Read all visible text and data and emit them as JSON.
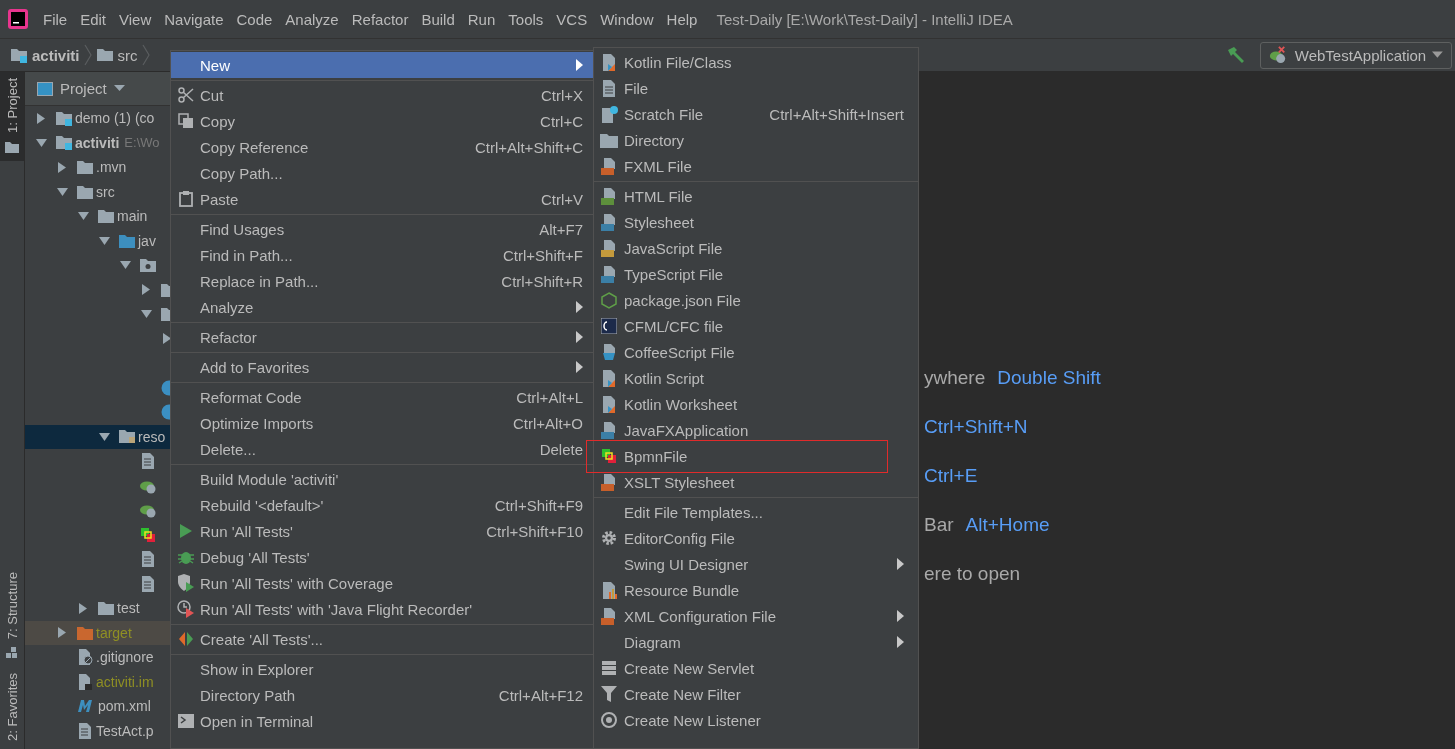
{
  "title_bar": {
    "menus": [
      "File",
      "Edit",
      "View",
      "Navigate",
      "Code",
      "Analyze",
      "Refactor",
      "Build",
      "Run",
      "Tools",
      "VCS",
      "Window",
      "Help"
    ],
    "title": "Test-Daily [E:\\Work\\Test-Daily] - IntelliJ IDEA"
  },
  "nav_bar": {
    "crumbs": [
      {
        "label": "activiti",
        "kind": "module"
      },
      {
        "label": "src",
        "kind": "folder"
      }
    ],
    "run_config": "WebTestApplication"
  },
  "tool_strip": {
    "top": [
      {
        "label": "1: Project",
        "selected": true
      }
    ],
    "bottom": [
      {
        "label": "7: Structure",
        "selected": false
      },
      {
        "label": "2: Favorites",
        "selected": false
      }
    ]
  },
  "project": {
    "title": "Project",
    "tree": [
      {
        "label": "demo (1) (co",
        "kind": "module",
        "expanded": false,
        "selected": false
      },
      {
        "label": "activiti",
        "extra": "E:\\Wo",
        "kind": "module",
        "expanded": true,
        "selected": false,
        "children": [
          {
            "label": ".mvn",
            "kind": "folder",
            "expanded": false,
            "selected": false
          },
          {
            "label": "src",
            "kind": "folder",
            "expanded": true,
            "selected": false,
            "children": [
              {
                "label": "main",
                "kind": "folder",
                "expanded": true,
                "selected": false,
                "children": [
                  {
                    "label": "jav",
                    "kind": "source-folder",
                    "expanded": true,
                    "selected": false,
                    "children": [
                      {
                        "kind": "package",
                        "expanded": true,
                        "selected": false,
                        "children": [
                          {
                            "kind": "folder",
                            "expanded": false,
                            "selected": false
                          },
                          {
                            "kind": "folder",
                            "expanded": true,
                            "selected": false,
                            "children": [
                              {
                                "kind": "offscreen",
                                "expanded": false,
                                "selected": false
                              },
                              {
                                "kind": "blank",
                                "selected": false
                              }
                            ]
                          },
                          {
                            "kind": "class",
                            "selected": false
                          },
                          {
                            "kind": "class",
                            "selected": false
                          }
                        ]
                      }
                    ]
                  },
                  {
                    "label": "reso",
                    "kind": "resources-folder",
                    "expanded": true,
                    "selected": true,
                    "children": [
                      {
                        "kind": "file",
                        "selected": false
                      },
                      {
                        "kind": "spring",
                        "selected": false
                      },
                      {
                        "kind": "spring",
                        "selected": false
                      },
                      {
                        "kind": "bpmn",
                        "selected": false
                      },
                      {
                        "kind": "file",
                        "selected": false
                      },
                      {
                        "kind": "file",
                        "selected": false
                      }
                    ]
                  }
                ]
              },
              {
                "label": "test",
                "kind": "folder",
                "expanded": false,
                "selected": false
              }
            ]
          },
          {
            "label": "target",
            "kind": "excluded-folder",
            "color": "#8f8f24",
            "excluded": true,
            "expanded": false,
            "selected": false
          },
          {
            "label": ".gitignore",
            "kind": "ignore-file",
            "selected": false
          },
          {
            "label": "activiti.im",
            "kind": "iml",
            "color": "#8f8f24",
            "selected": false
          },
          {
            "label": "pom.xml",
            "kind": "maven",
            "selected": false
          },
          {
            "label": "TestAct.p",
            "kind": "file",
            "selected": false
          }
        ]
      }
    ]
  },
  "context_menu": {
    "groups": [
      [
        {
          "label": "New",
          "kind": "plain",
          "submenu": true,
          "selected": true
        }
      ],
      [
        {
          "label": "Cut",
          "shortcut": "Ctrl+X",
          "kind": "cut",
          "selected": false
        },
        {
          "label": "Copy",
          "shortcut": "Ctrl+C",
          "kind": "copy",
          "selected": false
        },
        {
          "label": "Copy Reference",
          "shortcut": "Ctrl+Alt+Shift+C",
          "kind": "plain",
          "selected": false
        },
        {
          "label": "Copy Path...",
          "kind": "plain",
          "selected": false
        },
        {
          "label": "Paste",
          "shortcut": "Ctrl+V",
          "kind": "paste",
          "selected": false
        }
      ],
      [
        {
          "label": "Find Usages",
          "shortcut": "Alt+F7",
          "kind": "plain",
          "selected": false
        },
        {
          "label": "Find in Path...",
          "shortcut": "Ctrl+Shift+F",
          "kind": "plain",
          "selected": false
        },
        {
          "label": "Replace in Path...",
          "shortcut": "Ctrl+Shift+R",
          "kind": "plain",
          "selected": false
        },
        {
          "label": "Analyze",
          "kind": "plain",
          "submenu": true,
          "selected": false
        }
      ],
      [
        {
          "label": "Refactor",
          "kind": "plain",
          "submenu": true,
          "selected": false
        }
      ],
      [
        {
          "label": "Add to Favorites",
          "kind": "plain",
          "submenu": true,
          "selected": false
        }
      ],
      [
        {
          "label": "Reformat Code",
          "shortcut": "Ctrl+Alt+L",
          "kind": "plain",
          "selected": false
        },
        {
          "label": "Optimize Imports",
          "shortcut": "Ctrl+Alt+O",
          "kind": "plain",
          "selected": false
        },
        {
          "label": "Delete...",
          "shortcut": "Delete",
          "kind": "plain",
          "selected": false
        }
      ],
      [
        {
          "label": "Build Module 'activiti'",
          "kind": "plain",
          "selected": false
        },
        {
          "label": "Rebuild '<default>'",
          "shortcut": "Ctrl+Shift+F9",
          "kind": "plain",
          "selected": false
        },
        {
          "label": "Run 'All Tests'",
          "shortcut": "Ctrl+Shift+F10",
          "kind": "run",
          "selected": false
        },
        {
          "label": "Debug 'All Tests'",
          "kind": "debug",
          "selected": false
        },
        {
          "label": "Run 'All Tests' with Coverage",
          "kind": "coverage",
          "selected": false
        },
        {
          "label": "Run 'All Tests' with 'Java Flight Recorder'",
          "kind": "profiler",
          "selected": false
        }
      ],
      [
        {
          "label": "Create 'All Tests'...",
          "kind": "create",
          "selected": false
        }
      ],
      [
        {
          "label": "Show in Explorer",
          "kind": "plain",
          "selected": false
        },
        {
          "label": "Directory Path",
          "shortcut": "Ctrl+Alt+F12",
          "kind": "plain",
          "selected": false
        },
        {
          "label": "Open in Terminal",
          "kind": "terminal",
          "selected": false
        }
      ]
    ]
  },
  "new_submenu": {
    "groups": [
      [
        {
          "label": "Kotlin File/Class",
          "kind": "kotlin",
          "selected": false
        },
        {
          "label": "File",
          "kind": "file",
          "selected": false
        },
        {
          "label": "Scratch File",
          "shortcut": "Ctrl+Alt+Shift+Insert",
          "kind": "scratch",
          "selected": false
        },
        {
          "label": "Directory",
          "kind": "directory",
          "selected": false
        },
        {
          "label": "FXML File",
          "kind": "fxml",
          "selected": false
        }
      ],
      [
        {
          "label": "HTML File",
          "kind": "html",
          "selected": false
        },
        {
          "label": "Stylesheet",
          "kind": "css",
          "selected": false
        },
        {
          "label": "JavaScript File",
          "kind": "js",
          "selected": false
        },
        {
          "label": "TypeScript File",
          "kind": "ts",
          "selected": false
        },
        {
          "label": "package.json File",
          "kind": "nodejs",
          "selected": false
        },
        {
          "label": "CFML/CFC file",
          "kind": "cfml",
          "selected": false
        },
        {
          "label": "CoffeeScript File",
          "kind": "coffee",
          "selected": false
        },
        {
          "label": "Kotlin Script",
          "kind": "kotlin",
          "selected": false
        },
        {
          "label": "Kotlin Worksheet",
          "kind": "kotlin",
          "selected": false
        },
        {
          "label": "JavaFXApplication",
          "kind": "javafx",
          "selected": false
        },
        {
          "label": "BpmnFile",
          "kind": "bpmn",
          "selected": false,
          "annotated": true
        },
        {
          "label": "XSLT Stylesheet",
          "kind": "xslt",
          "selected": false
        }
      ],
      [
        {
          "label": "Edit File Templates...",
          "kind": "plain",
          "selected": false
        },
        {
          "label": "EditorConfig File",
          "kind": "gear",
          "selected": false
        },
        {
          "label": "Swing UI Designer",
          "kind": "plain",
          "submenu": true,
          "selected": false
        },
        {
          "label": "Resource Bundle",
          "kind": "bundle",
          "selected": false
        },
        {
          "label": "XML Configuration File",
          "kind": "xml",
          "submenu": true,
          "selected": false
        },
        {
          "label": "Diagram",
          "kind": "plain",
          "submenu": true,
          "selected": false
        },
        {
          "label": "Create New Servlet",
          "kind": "servlet",
          "selected": false
        },
        {
          "label": "Create New Filter",
          "kind": "filter",
          "selected": false
        },
        {
          "label": "Create New Listener",
          "kind": "listener",
          "selected": false
        }
      ]
    ]
  },
  "editor_hints": [
    {
      "label": "ywhere",
      "shortcut": "Double Shift"
    },
    {
      "shortcut": "Ctrl+Shift+N"
    },
    {
      "shortcut": "Ctrl+E"
    },
    {
      "label": "Bar",
      "shortcut": "Alt+Home"
    },
    {
      "label": "ere to open"
    }
  ]
}
